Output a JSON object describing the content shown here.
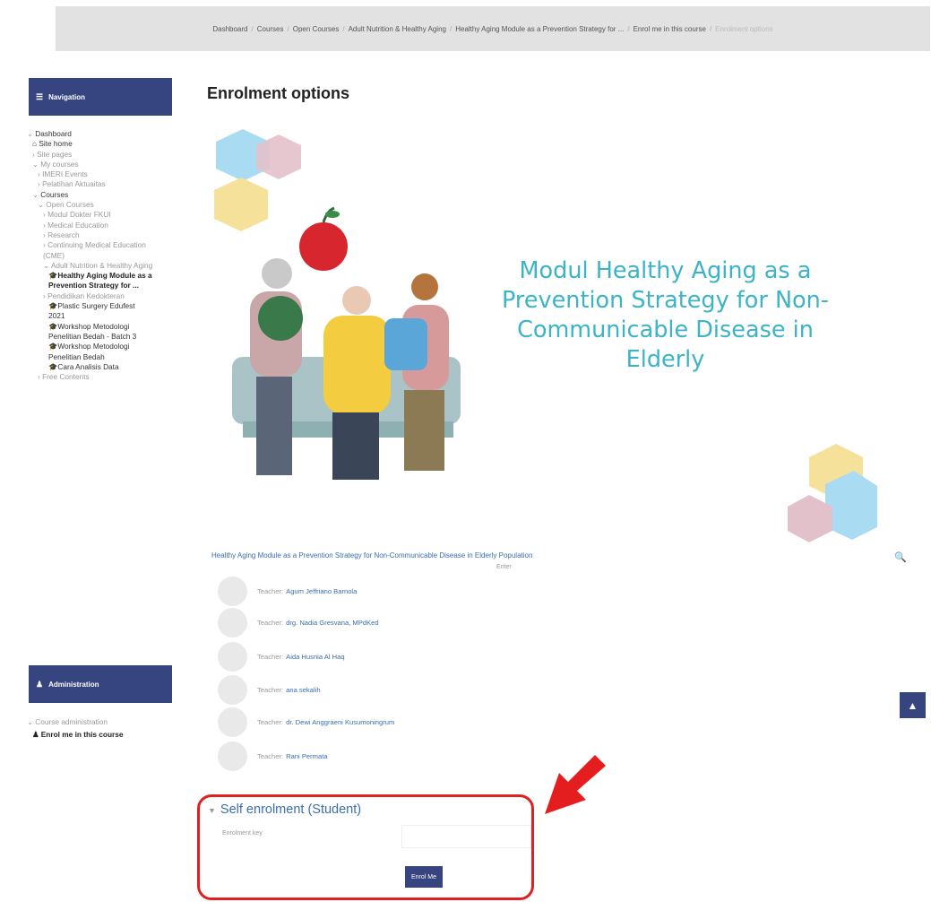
{
  "breadcrumb": [
    "Dashboard",
    "Courses",
    "Open Courses",
    "Adult Nutrition & Healthy Aging",
    "Healthy Aging Module as a Prevention Strategy for ...",
    "Enrol me in this course",
    "Enrolment options"
  ],
  "nav": {
    "title": "Navigation",
    "items": [
      "Dashboard",
      "Site home",
      "Site pages",
      "My courses",
      "IMERI Events",
      "Pelatihan Aktuaitas",
      "Courses",
      "Open Courses",
      "Modul Dokter FKUI",
      "Medical Education",
      "Research",
      "Continuing Medical Education (CME)",
      "Adult Nutrition & Healthy Aging",
      "Healthy Aging Module as a Prevention Strategy for ...",
      "Pendidikan Kedokteran",
      "Plastic Surgery Edufest 2021",
      "Workshop Metodologi Penelitian Bedah - Batch 3",
      "Workshop Metodologi Penelitian Bedah",
      "Cara Analisis Data",
      "Free Contents"
    ]
  },
  "page_title": "Enrolment options",
  "hero_text": "Modul Healthy Aging as a Prevention Strategy for Non-Communicable Disease in Elderly",
  "course_name": "Healthy Aging Module as a Prevention Strategy for Non-Communicable Disease in Elderly Population",
  "enter_label": "Enter",
  "teacher_label": "Teacher:",
  "teachers": [
    "Agum Jeffriano Barnola",
    "drg. Nadia Gresvana, MPdKed",
    "Aida Husnia Al Haq",
    "ana sekalih",
    "dr. Dewi Anggraeni Kusumoningrum",
    "Rani Permata"
  ],
  "admin": {
    "title": "Administration",
    "items": [
      "Course administration",
      "Enrol me in this course"
    ]
  },
  "self_enrolment": {
    "title": "Self enrolment (Student)",
    "key_label": "Enrolment key",
    "key_value": "",
    "button": "Enrol Me"
  },
  "colors": {
    "accent": "#364480",
    "link": "#3a6fb0",
    "highlight": "#e02020",
    "hero_text": "#3cb4c8"
  }
}
